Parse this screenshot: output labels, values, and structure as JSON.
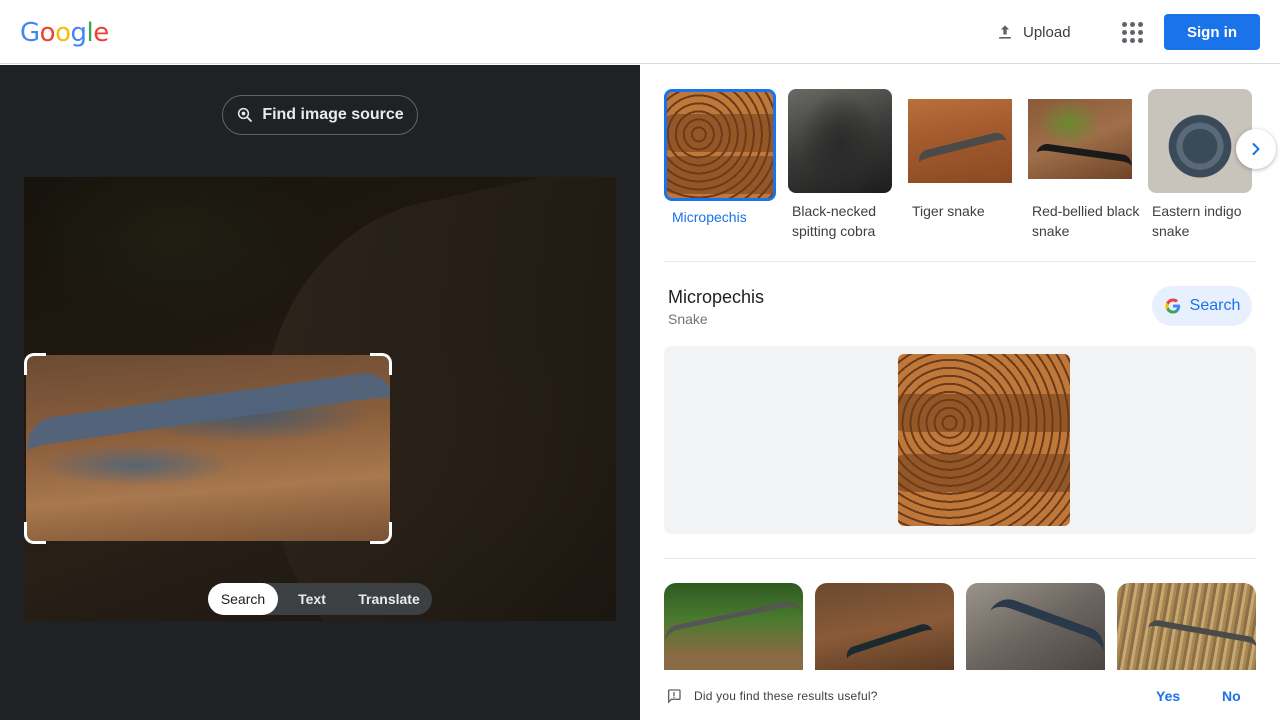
{
  "header": {
    "logo_letters": [
      {
        "ch": "G",
        "color": "#4285f4"
      },
      {
        "ch": "o",
        "color": "#ea4335"
      },
      {
        "ch": "o",
        "color": "#fbbc05"
      },
      {
        "ch": "g",
        "color": "#4285f4"
      },
      {
        "ch": "l",
        "color": "#34a853"
      },
      {
        "ch": "e",
        "color": "#ea4335"
      }
    ],
    "upload_label": "Upload",
    "apps_icon": "apps-grid-icon",
    "signin_label": "Sign in"
  },
  "left": {
    "find_source_label": "Find image source",
    "modes": [
      {
        "label": "Search",
        "active": true
      },
      {
        "label": "Text",
        "active": false
      },
      {
        "label": "Translate",
        "active": false
      }
    ]
  },
  "results": {
    "chips": [
      {
        "label": "Micropechis",
        "active": true
      },
      {
        "label": "Black-necked spitting cobra",
        "active": false
      },
      {
        "label": "Tiger snake",
        "active": false
      },
      {
        "label": "Red-bellied black snake",
        "active": false
      },
      {
        "label": "Eastern indigo snake",
        "active": false
      }
    ],
    "kg": {
      "title": "Micropechis",
      "subtitle": "Snake",
      "search_label": "Search"
    }
  },
  "feedback": {
    "question": "Did you find these results useful?",
    "yes": "Yes",
    "no": "No"
  },
  "colors": {
    "accent": "#1a73e8",
    "dark_panel": "#202124"
  }
}
